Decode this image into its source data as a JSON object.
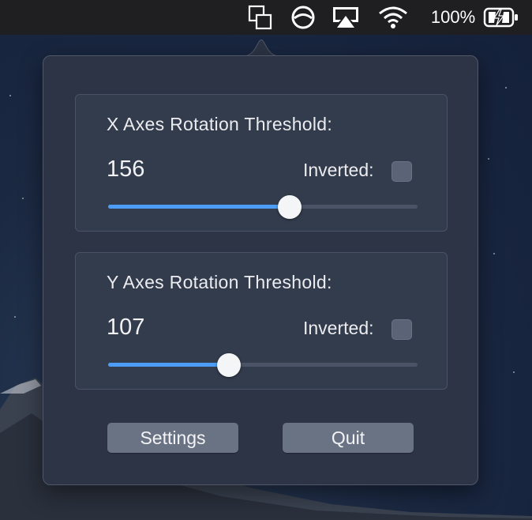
{
  "menubar": {
    "icons": [
      "app-windows-icon",
      "circle-slash-icon",
      "airplay-icon",
      "wifi-icon"
    ],
    "battery_percent_text": "100%",
    "battery_icon": "battery-charging-icon"
  },
  "popover": {
    "x_axis": {
      "title": "X Axes Rotation Threshold:",
      "value": "156",
      "inverted_label": "Inverted:",
      "inverted_checked": false,
      "slider_fraction": 0.586
    },
    "y_axis": {
      "title": "Y Axes Rotation Threshold:",
      "value": "107",
      "inverted_label": "Inverted:",
      "inverted_checked": false,
      "slider_fraction": 0.39
    },
    "buttons": {
      "settings_label": "Settings",
      "quit_label": "Quit"
    }
  },
  "colors": {
    "accent": "#4d9df6",
    "panel": "#2c3445",
    "menubar": "#1f1f22"
  }
}
